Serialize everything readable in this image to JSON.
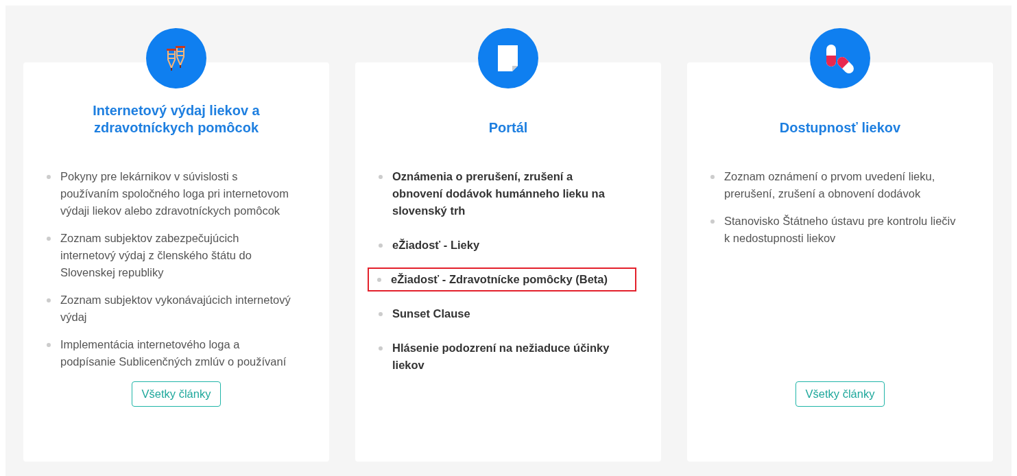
{
  "cards": [
    {
      "kind": "crutches",
      "title": "Internetový výdaj liekov a zdravotníckych pomôcok",
      "bold_items": false,
      "items": [
        {
          "text": "Pokyny pre lekárnikov v súvislosti s používaním spoločného loga pri internetovom výdaji liekov alebo zdravotníckych pomôcok",
          "highlighted": false
        },
        {
          "text": "Zoznam subjektov zabezpečujúcich internetový výdaj z členského štátu do Slovenskej republiky",
          "highlighted": false
        },
        {
          "text": "Zoznam subjektov vykonávajúcich internetový výdaj",
          "highlighted": false
        },
        {
          "text": "Implementácia internetového loga a podpísanie Sublicenčných zmlúv o používaní",
          "highlighted": false
        }
      ],
      "button": "Všetky články"
    },
    {
      "kind": "document",
      "title": "Portál",
      "bold_items": true,
      "items": [
        {
          "text": "Oznámenia o prerušení, zrušení a obnovení dodávok humánneho lieku na slovenský trh",
          "highlighted": false
        },
        {
          "text": "eŽiadosť - Lieky",
          "highlighted": false
        },
        {
          "text": "eŽiadosť - Zdravotnícke pomôcky (Beta)",
          "highlighted": true
        },
        {
          "text": "Sunset Clause",
          "highlighted": false
        },
        {
          "text": "Hlásenie podozrení na nežiaduce účinky liekov",
          "highlighted": false
        }
      ]
    },
    {
      "kind": "pills",
      "title": "Dostupnosť liekov",
      "bold_items": false,
      "items": [
        {
          "text": "Zoznam oznámení o prvom uvedení lieku, prerušení, zrušení a obnovení dodávok",
          "highlighted": false
        },
        {
          "text": "Stanovisko Štátneho ústavu pre kontrolu liečiv k nedostupnosti liekov",
          "highlighted": false
        }
      ],
      "button": "Všetky články"
    }
  ]
}
